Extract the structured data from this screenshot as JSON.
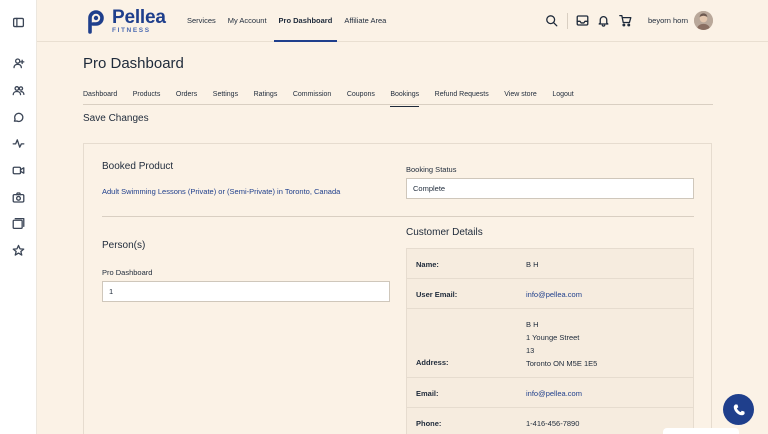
{
  "brand": {
    "name": "Pellea",
    "tagline": "FITNESS",
    "accent": "#1f3f8c",
    "background": "#fbf2e6"
  },
  "rail": {
    "icons": [
      "sidebar-toggle-icon",
      "user-plus-icon",
      "users-icon",
      "chat-icon",
      "activity-icon",
      "video-icon",
      "camera-icon",
      "gallery-icon",
      "star-icon"
    ]
  },
  "topnav": {
    "items": [
      "Services",
      "My Account",
      "Pro Dashboard",
      "Affiliate Area"
    ],
    "active": "Pro Dashboard"
  },
  "header": {
    "username": "beyorn horn",
    "icons": [
      "search-icon",
      "inbox-icon",
      "bell-icon",
      "cart-icon"
    ]
  },
  "page": {
    "title": "Pro Dashboard",
    "tabs": [
      "Dashboard",
      "Products",
      "Orders",
      "Settings",
      "Ratings",
      "Commission",
      "Coupons",
      "Bookings",
      "Refund Requests",
      "View store",
      "Logout"
    ],
    "active_tab": "Bookings",
    "save_label": "Save Changes"
  },
  "booking": {
    "product_label": "Booked Product",
    "product_link": "Adult Swimming Lessons (Private) or (Semi-Private) in Toronto, Canada",
    "status_label": "Booking Status",
    "status_value": "Complete",
    "persons_label": "Person(s)",
    "persons_field_label": "Pro Dashboard",
    "persons_value": "1"
  },
  "customer": {
    "title": "Customer Details",
    "name_key": "Name:",
    "name_value": "B H",
    "user_email_key": "User Email:",
    "user_email_value": "info@pellea.com",
    "address_key": "Address:",
    "address_lines": [
      "B H",
      "1 Younge Street",
      "13",
      "Toronto ON M5E 1E5"
    ],
    "email_key": "Email:",
    "email_value": "info@pellea.com",
    "phone_key": "Phone:",
    "phone_value": "1-416-456-7890"
  },
  "fab": {
    "icon": "phone-icon"
  }
}
